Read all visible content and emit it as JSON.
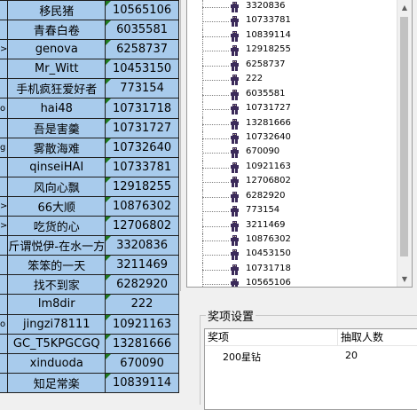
{
  "sheet": {
    "rows": [
      {
        "a": "",
        "b": "移民猪",
        "c": "10565106"
      },
      {
        "a": "",
        "b": "青春白卷",
        "c": "6035581"
      },
      {
        "a": ">",
        "b": "genova",
        "c": "6258737"
      },
      {
        "a": "",
        "b": "Mr_Witt",
        "c": "10453150"
      },
      {
        "a": "",
        "b": "手机疯狂爱好者",
        "c": "773154"
      },
      {
        "a": "o",
        "b": "hai48",
        "c": "10731718"
      },
      {
        "a": "",
        "b": "吾是害羹",
        "c": "10731727"
      },
      {
        "a": "g",
        "b": "雾散海难",
        "c": "10732640"
      },
      {
        "a": "",
        "b": "qinseiHAI",
        "c": "10733781"
      },
      {
        "a": "",
        "b": "风向心飘",
        "c": "12918255"
      },
      {
        "a": ">",
        "b": "66大顺",
        "c": "10876302"
      },
      {
        "a": ">",
        "b": "吃货的心",
        "c": "12706802"
      },
      {
        "a": "",
        "b": "斤谓悦伊-在水一方",
        "c": "3320836"
      },
      {
        "a": "",
        "b": "笨笨的一天",
        "c": "3211469"
      },
      {
        "a": "",
        "b": "找不到家",
        "c": "6282920"
      },
      {
        "a": "",
        "b": "lm8dir",
        "c": "222"
      },
      {
        "a": "o",
        "b": "jingzi78111",
        "c": "10921163"
      },
      {
        "a": "",
        "b": "GC_T5KPGCGQ",
        "c": "13281666"
      },
      {
        "a": "",
        "b": "xinduoda",
        "c": "670090"
      },
      {
        "a": "",
        "b": "知足常楽",
        "c": "10839114"
      }
    ]
  },
  "tree": {
    "items": [
      "3320836",
      "10733781",
      "10839114",
      "12918255",
      "6258737",
      "222",
      "6035581",
      "10731727",
      "13281666",
      "10732640",
      "670090",
      "10921163",
      "12706802",
      "6282920",
      "773154",
      "3211469",
      "10876302",
      "10453150",
      "10731718",
      "10565106"
    ]
  },
  "prize": {
    "legend": "奖项设置",
    "col_award": "奖项",
    "col_count": "抽取人数",
    "row_award": "200星钻",
    "row_count": "20"
  },
  "colors": {
    "cell_bg": "#a8cbec",
    "corner_marker": "#1f7a1f",
    "node_icon": "#3b2a5a"
  }
}
